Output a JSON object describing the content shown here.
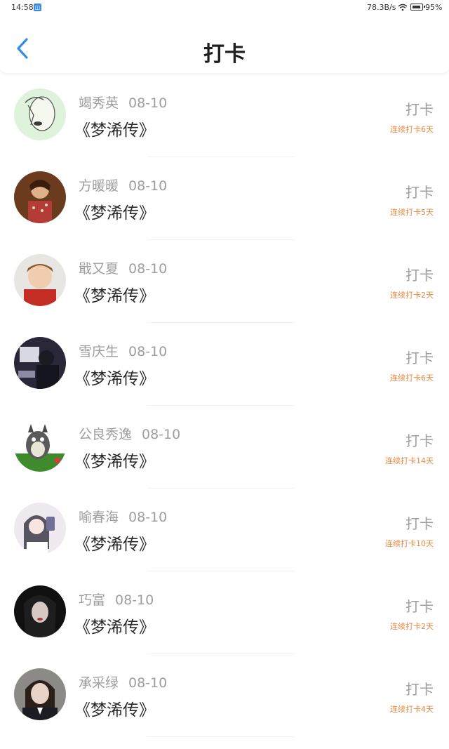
{
  "status_bar": {
    "time": "14:58",
    "network_speed": "78.3B/s",
    "battery": "95%"
  },
  "header": {
    "title": "打卡",
    "back_icon": "chevron-left-icon",
    "accent_color": "#2f8ee6"
  },
  "records": [
    {
      "name": "竭秀英",
      "date": "08-10",
      "book": "《梦浠传》",
      "action": "打卡",
      "streak": "连续打卡6天"
    },
    {
      "name": "方暖暖",
      "date": "08-10",
      "book": "《梦浠传》",
      "action": "打卡",
      "streak": "连续打卡5天"
    },
    {
      "name": "戢又夏",
      "date": "08-10",
      "book": "《梦浠传》",
      "action": "打卡",
      "streak": "连续打卡2天"
    },
    {
      "name": "雪庆生",
      "date": "08-10",
      "book": "《梦浠传》",
      "action": "打卡",
      "streak": "连续打卡6天"
    },
    {
      "name": "公良秀逸",
      "date": "08-10",
      "book": "《梦浠传》",
      "action": "打卡",
      "streak": "连续打卡14天"
    },
    {
      "name": "喻春海",
      "date": "08-10",
      "book": "《梦浠传》",
      "action": "打卡",
      "streak": "连续打卡10天"
    },
    {
      "name": "巧富",
      "date": "08-10",
      "book": "《梦浠传》",
      "action": "打卡",
      "streak": "连续打卡2天"
    },
    {
      "name": "承采绿",
      "date": "08-10",
      "book": "《梦浠传》",
      "action": "打卡",
      "streak": "连续打卡4天"
    }
  ],
  "colors": {
    "name_gray": "#9e9e9e",
    "streak_orange": "#ea8740"
  }
}
